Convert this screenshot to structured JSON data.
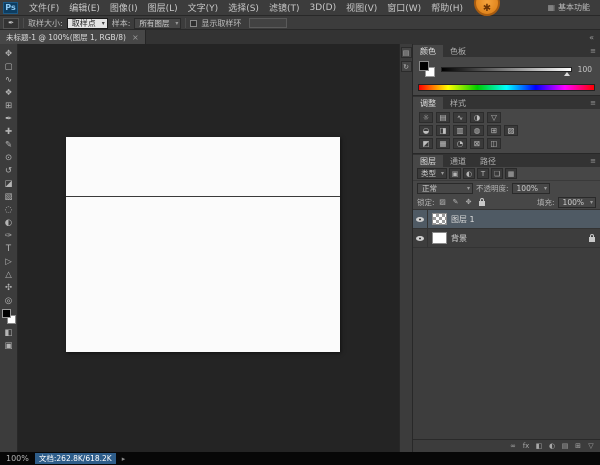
{
  "app": {
    "logo": "Ps",
    "workspace": "基本功能",
    "workspace_icon": "▦",
    "badge_icon": "✱"
  },
  "colors": {
    "selection_blue": "#2e5d8a",
    "layer_selected": "#4f5a64",
    "canvas_background": "#242424"
  },
  "menu_bar": {
    "items": [
      "文件(F)",
      "编辑(E)",
      "图像(I)",
      "图层(L)",
      "文字(Y)",
      "选择(S)",
      "滤镜(T)",
      "3D(D)",
      "视图(V)",
      "窗口(W)",
      "帮助(H)"
    ]
  },
  "options_bar": {
    "tool_icon": "✒",
    "sample_size_label": "取样大小:",
    "sample_size_value": "取样点",
    "sample_label": "样本:",
    "sample_value": "所有图层",
    "show_ring_label": "显示取样环"
  },
  "document_tab": {
    "title": "未标题-1 @ 100%(图层 1, RGB/8)",
    "close_icon": "×"
  },
  "toolbar": {
    "tools": [
      {
        "name": "move",
        "glyph": "✥"
      },
      {
        "name": "marquee",
        "glyph": "▢"
      },
      {
        "name": "lasso",
        "glyph": "∿"
      },
      {
        "name": "quick-selection",
        "glyph": "❖"
      },
      {
        "name": "crop",
        "glyph": "⊞"
      },
      {
        "name": "eyedropper",
        "glyph": "✒"
      },
      {
        "name": "healing-brush",
        "glyph": "✚"
      },
      {
        "name": "brush",
        "glyph": "✎"
      },
      {
        "name": "clone-stamp",
        "glyph": "⊙"
      },
      {
        "name": "history-brush",
        "glyph": "↺"
      },
      {
        "name": "eraser",
        "glyph": "◪"
      },
      {
        "name": "gradient",
        "glyph": "▧"
      },
      {
        "name": "blur",
        "glyph": "◌"
      },
      {
        "name": "dodge",
        "glyph": "◐"
      },
      {
        "name": "pen",
        "glyph": "✑"
      },
      {
        "name": "type",
        "glyph": "T"
      },
      {
        "name": "path-selection",
        "glyph": "▷"
      },
      {
        "name": "shape",
        "glyph": "△"
      },
      {
        "name": "hand",
        "glyph": "✣"
      },
      {
        "name": "zoom",
        "glyph": "◎"
      }
    ],
    "extra": [
      {
        "name": "quick-mask",
        "glyph": "◧"
      },
      {
        "name": "screen-mode",
        "glyph": "▣"
      }
    ]
  },
  "dock_icons": [
    {
      "name": "properties",
      "glyph": "▤"
    },
    {
      "name": "history",
      "glyph": "↻"
    }
  ],
  "panels": {
    "panel_menu_icon": "≡",
    "collapse_icon": "«",
    "color": {
      "tabs": [
        "颜色",
        "色板"
      ],
      "value": "100"
    },
    "adjustments": {
      "tabs": [
        "调整",
        "样式"
      ],
      "icons": [
        "☼",
        "▤",
        "∿",
        "◑",
        "▽",
        "◒",
        "◨",
        "▥",
        "◍",
        "⊞",
        "▨",
        "◩",
        "▦",
        "◔",
        "⊠",
        "◫"
      ]
    },
    "layers": {
      "tabs": [
        "图层",
        "通道",
        "路径"
      ],
      "kind_label": "类型",
      "filter_icons": [
        "▣",
        "◐",
        "T",
        "❏",
        "▦"
      ],
      "blend_mode": "正常",
      "opacity_label": "不透明度:",
      "opacity_value": "100%",
      "lock_label": "锁定:",
      "lock_icons": [
        "▨",
        "✎",
        "✥"
      ],
      "fill_label": "填充:",
      "fill_value": "100%",
      "rows": [
        {
          "name": "图层 1"
        },
        {
          "name": "背景"
        }
      ],
      "bottom_icons": [
        "∞",
        "fx",
        "◧",
        "◐",
        "▤",
        "⊞",
        "▽"
      ]
    }
  },
  "status_bar": {
    "zoom": "100%",
    "doc_label": "文档:262.8K/618.2K",
    "expand_icon": "▸"
  }
}
